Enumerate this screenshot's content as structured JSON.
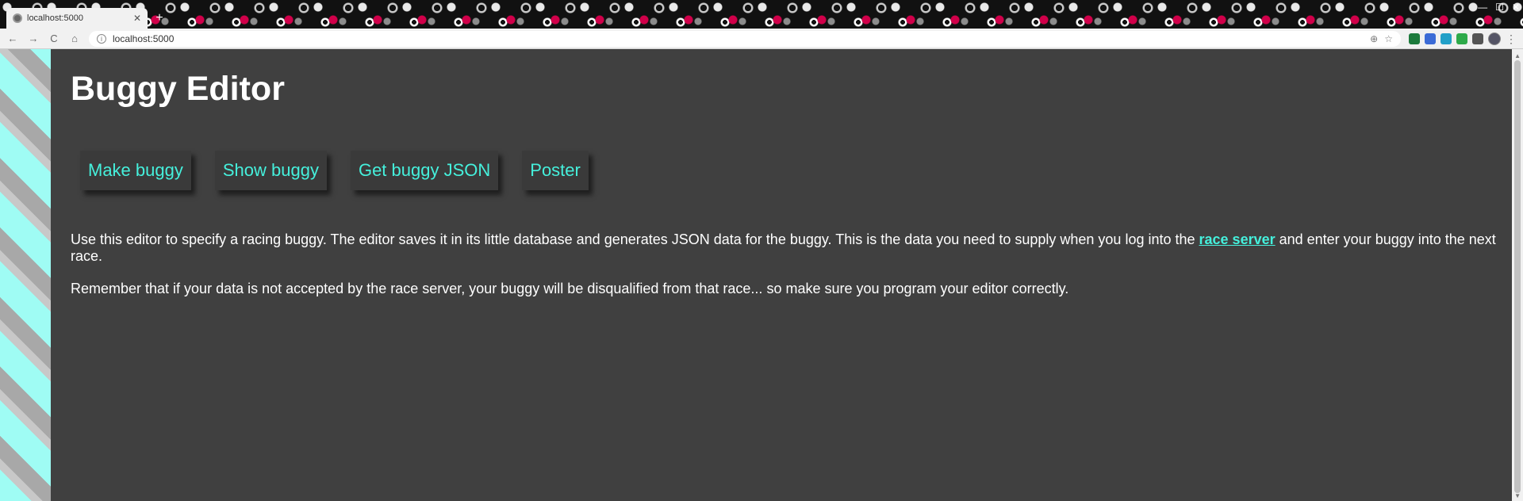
{
  "browser": {
    "tab_title": "localhost:5000",
    "tab_close": "✕",
    "new_tab": "+",
    "url": "localhost:5000",
    "back": "←",
    "forward": "→",
    "reload": "C",
    "home": "⌂",
    "info": "i",
    "zoom_icon": "⊕",
    "star_icon": "☆",
    "menu": "⋮",
    "minimize": "—",
    "maximize": "☐",
    "close_window": "✕",
    "extension_colors": [
      "#1c7a3c",
      "#3b6bd6",
      "#22a0c8",
      "#2eaa4a",
      "#555555"
    ]
  },
  "page": {
    "title": "Buggy Editor",
    "buttons": [
      {
        "label": "Make buggy"
      },
      {
        "label": "Show buggy"
      },
      {
        "label": "Get buggy JSON"
      },
      {
        "label": "Poster"
      }
    ],
    "intro_before": "Use this editor to specify a racing buggy. The editor saves it in its little database and generates JSON data for the buggy. This is the data you need to supply when you log into the ",
    "intro_link": "race server",
    "intro_after": " and enter your buggy into the next race.",
    "warning": "Remember that if your data is not accepted by the race server, your buggy will be disqualified from that race... so make sure you program your editor correctly.",
    "accent_color": "#45f0dc"
  }
}
